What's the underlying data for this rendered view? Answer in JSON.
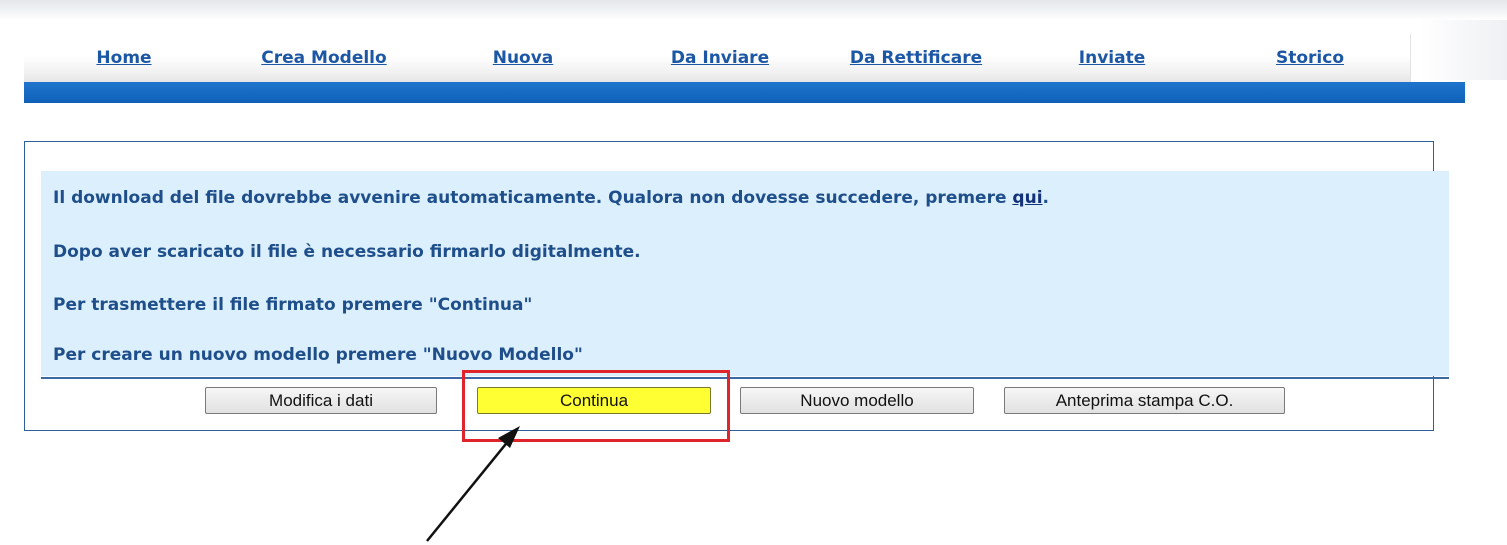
{
  "nav": {
    "tabs": [
      {
        "label": "Home"
      },
      {
        "label": "Crea Modello"
      },
      {
        "label": "Nuova"
      },
      {
        "label": "Da Inviare"
      },
      {
        "label": "Da Rettificare"
      },
      {
        "label": "Inviate"
      },
      {
        "label": "Storico"
      }
    ]
  },
  "message": {
    "line1_text": "Il download del file dovrebbe avvenire automaticamente. Qualora non dovesse succedere, premere ",
    "line1_link": "qui",
    "line1_end": ".",
    "line2": "Dopo aver scaricato il file è necessario firmarlo digitalmente.",
    "line3": "Per trasmettere il file firmato premere \"Continua\"",
    "line4": "Per creare un nuovo modello premere \"Nuovo Modello\""
  },
  "buttons": {
    "modify": "Modifica i dati",
    "continue": "Continua",
    "new_model": "Nuovo modello",
    "preview": "Anteprima stampa C.O."
  },
  "colors": {
    "tab_text": "#1c57a5",
    "nav_bar": "#1466bf",
    "message_bg": "#dceffd",
    "message_text": "#1f4f8b",
    "highlight_button": "#ffff33",
    "annotation_box": "#e0242c"
  }
}
